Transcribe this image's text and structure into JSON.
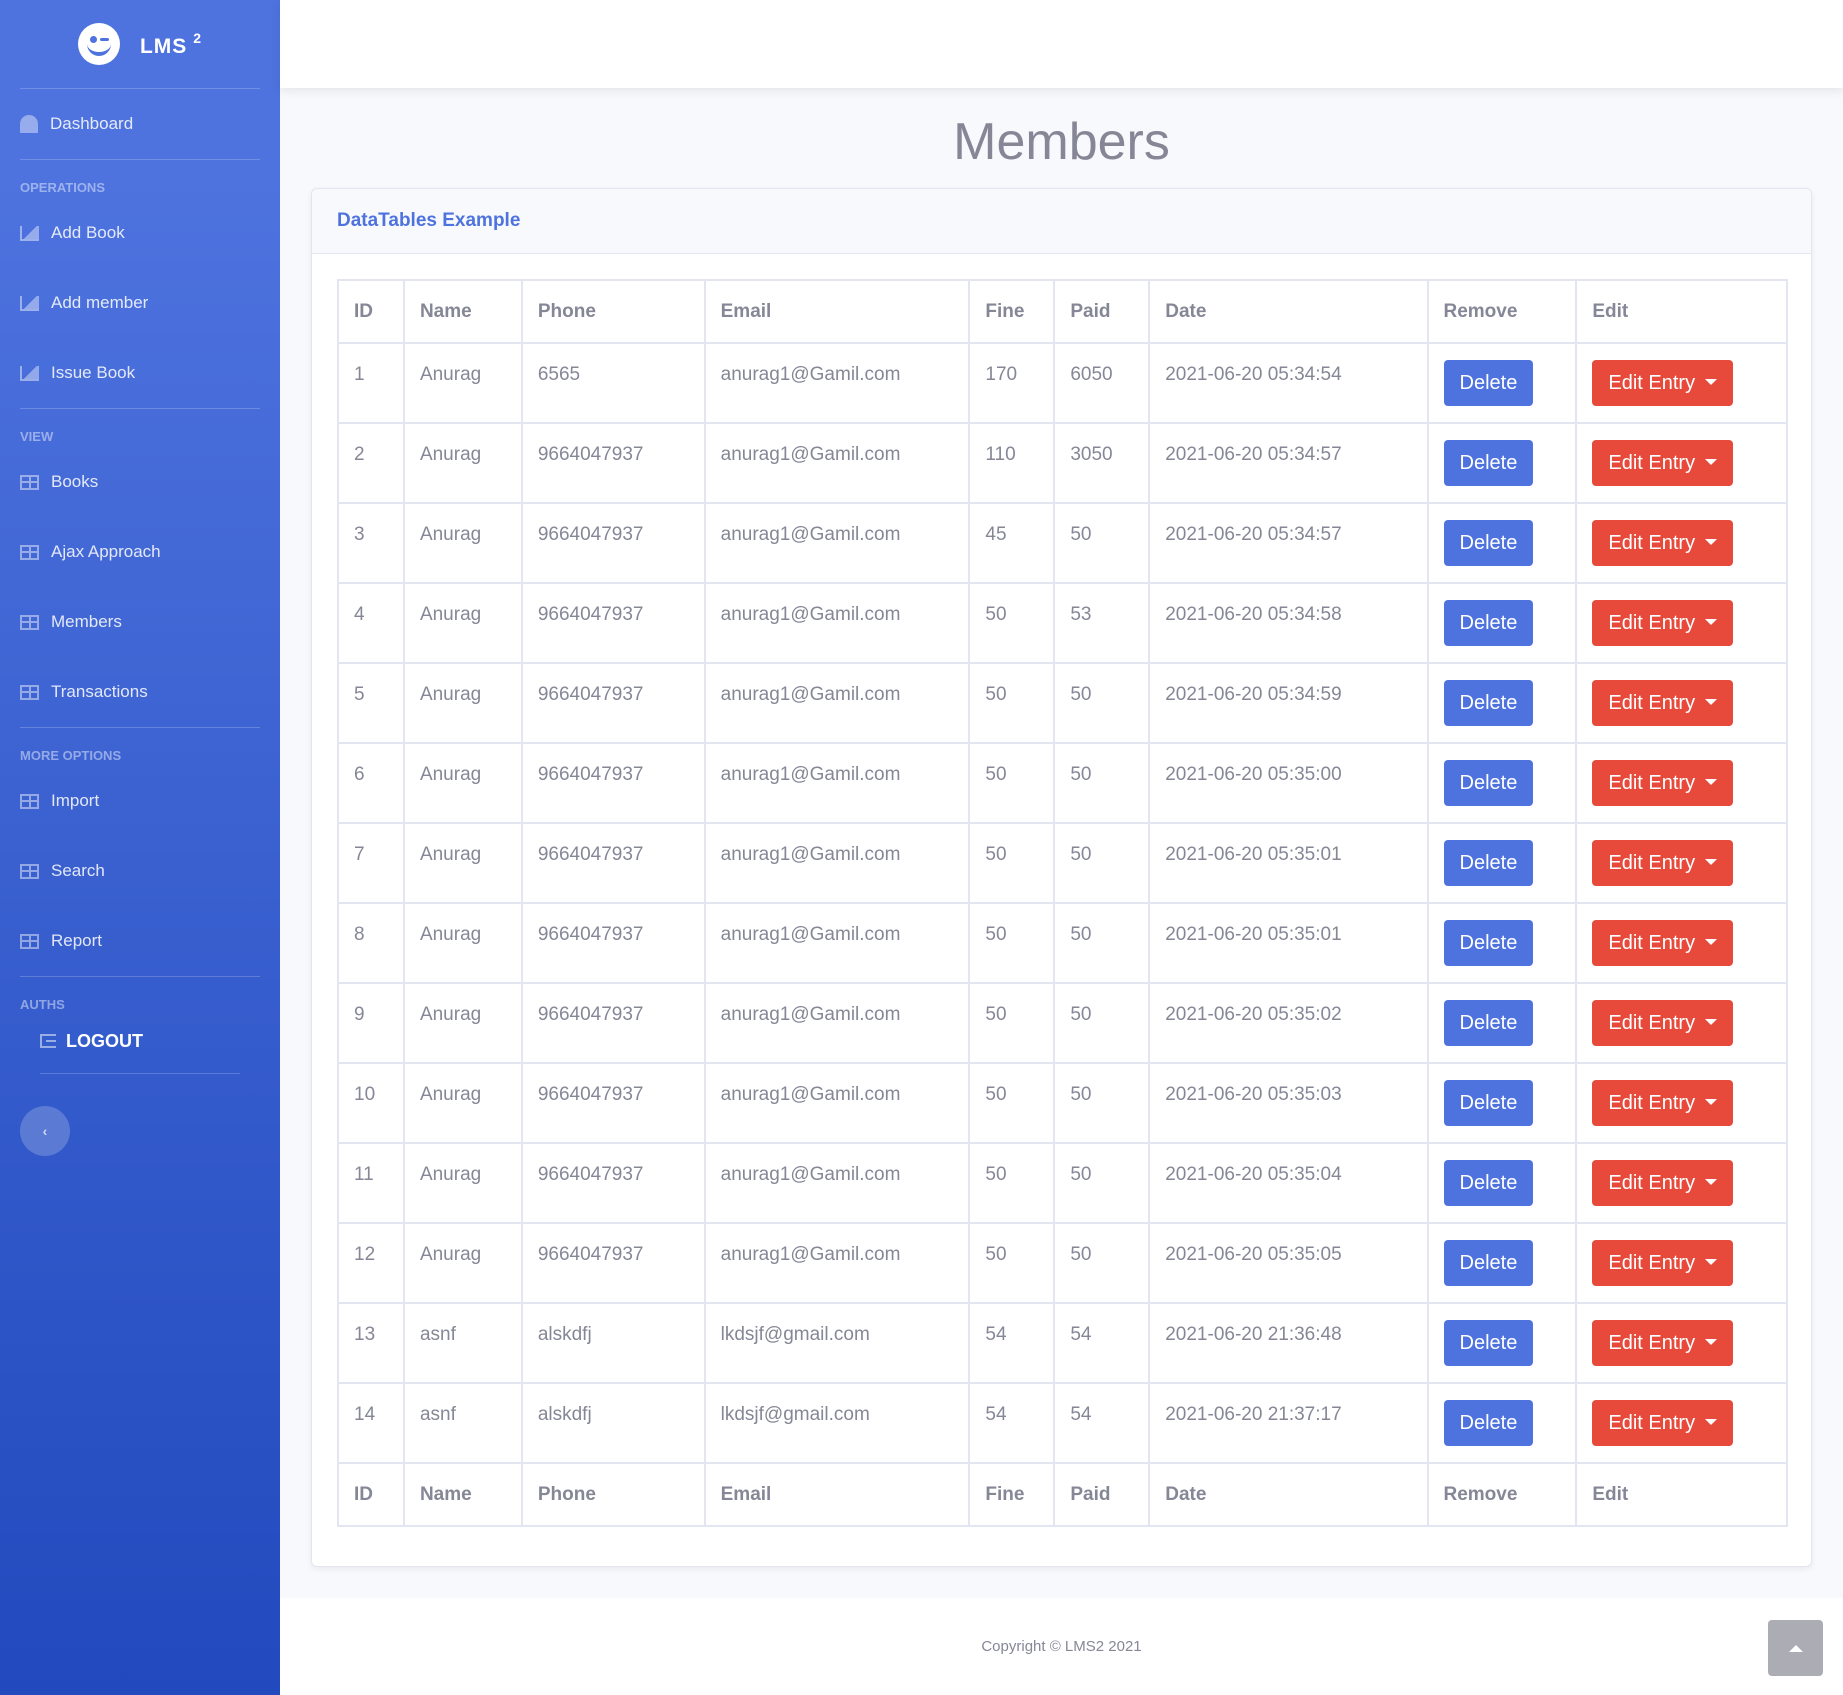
{
  "brand": {
    "name": "LMS",
    "superscript": "2"
  },
  "sidebar": {
    "dashboard": "Dashboard",
    "sections": [
      {
        "heading": "OPERATIONS",
        "items": [
          {
            "label": "Add Book",
            "icon": "chart-area-icon"
          },
          {
            "label": "Add member",
            "icon": "chart-area-icon"
          },
          {
            "label": "Issue Book",
            "icon": "chart-area-icon"
          }
        ]
      },
      {
        "heading": "VIEW",
        "items": [
          {
            "label": "Books",
            "icon": "table-icon"
          },
          {
            "label": "Ajax Approach",
            "icon": "table-icon"
          },
          {
            "label": "Members",
            "icon": "table-icon"
          },
          {
            "label": "Transactions",
            "icon": "table-icon"
          }
        ]
      },
      {
        "heading": "MORE OPTIONS",
        "items": [
          {
            "label": "Import",
            "icon": "table-icon"
          },
          {
            "label": "Search",
            "icon": "table-icon"
          },
          {
            "label": "Report",
            "icon": "table-icon"
          }
        ]
      },
      {
        "heading": "AUTHS",
        "items": []
      }
    ],
    "logout": "LOGOUT",
    "toggle": "‹"
  },
  "page": {
    "title": "Members"
  },
  "card": {
    "title": "DataTables Example"
  },
  "table": {
    "columns": [
      "ID",
      "Name",
      "Phone",
      "Email",
      "Fine",
      "Paid",
      "Date",
      "Remove",
      "Edit"
    ],
    "delete_label": "Delete",
    "edit_label": "Edit Entry",
    "rows": [
      [
        "1",
        "Anurag",
        "6565",
        "anurag1@Gamil.com",
        "170",
        "6050",
        "2021-06-20 05:34:54"
      ],
      [
        "2",
        "Anurag",
        "9664047937",
        "anurag1@Gamil.com",
        "110",
        "3050",
        "2021-06-20 05:34:57"
      ],
      [
        "3",
        "Anurag",
        "9664047937",
        "anurag1@Gamil.com",
        "45",
        "50",
        "2021-06-20 05:34:57"
      ],
      [
        "4",
        "Anurag",
        "9664047937",
        "anurag1@Gamil.com",
        "50",
        "53",
        "2021-06-20 05:34:58"
      ],
      [
        "5",
        "Anurag",
        "9664047937",
        "anurag1@Gamil.com",
        "50",
        "50",
        "2021-06-20 05:34:59"
      ],
      [
        "6",
        "Anurag",
        "9664047937",
        "anurag1@Gamil.com",
        "50",
        "50",
        "2021-06-20 05:35:00"
      ],
      [
        "7",
        "Anurag",
        "9664047937",
        "anurag1@Gamil.com",
        "50",
        "50",
        "2021-06-20 05:35:01"
      ],
      [
        "8",
        "Anurag",
        "9664047937",
        "anurag1@Gamil.com",
        "50",
        "50",
        "2021-06-20 05:35:01"
      ],
      [
        "9",
        "Anurag",
        "9664047937",
        "anurag1@Gamil.com",
        "50",
        "50",
        "2021-06-20 05:35:02"
      ],
      [
        "10",
        "Anurag",
        "9664047937",
        "anurag1@Gamil.com",
        "50",
        "50",
        "2021-06-20 05:35:03"
      ],
      [
        "11",
        "Anurag",
        "9664047937",
        "anurag1@Gamil.com",
        "50",
        "50",
        "2021-06-20 05:35:04"
      ],
      [
        "12",
        "Anurag",
        "9664047937",
        "anurag1@Gamil.com",
        "50",
        "50",
        "2021-06-20 05:35:05"
      ],
      [
        "13",
        "asnf",
        "alskdfj",
        "lkdsjf@gmail.com",
        "54",
        "54",
        "2021-06-20 21:36:48"
      ],
      [
        "14",
        "asnf",
        "alskdfj",
        "lkdsjf@gmail.com",
        "54",
        "54",
        "2021-06-20 21:37:17"
      ]
    ]
  },
  "footer": {
    "copyright": "Copyright © LMS2 2021"
  },
  "colors": {
    "primary": "#4e73df",
    "danger": "#e74a3b",
    "text": "#858796"
  }
}
